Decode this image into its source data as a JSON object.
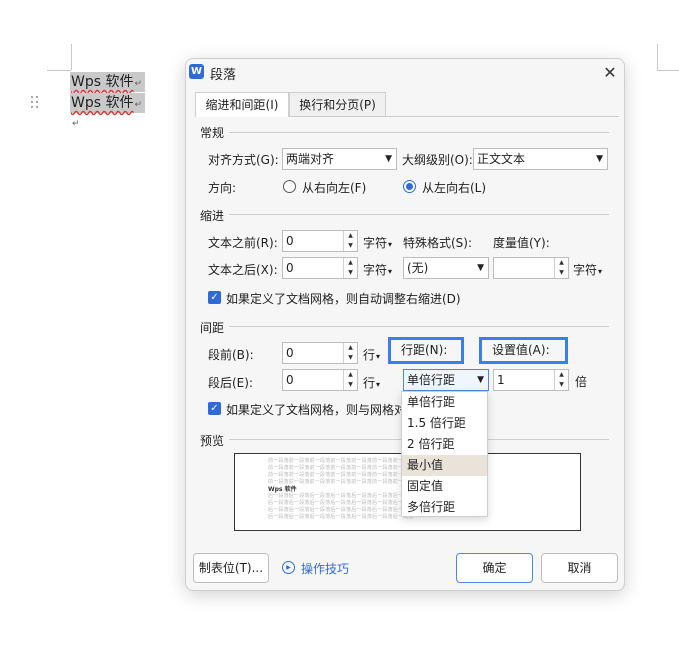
{
  "document": {
    "lines": [
      "Wps 软件",
      "Wps 软件"
    ],
    "para_mark": "↵"
  },
  "dialog": {
    "app_icon": "W",
    "title": "段落",
    "close_icon": "close-icon",
    "tabs": [
      "缩进和间距(I)",
      "换行和分页(P)"
    ],
    "general": {
      "heading": "常规",
      "align_label": "对齐方式(G):",
      "align_value": "两端对齐",
      "outline_label": "大纲级别(O):",
      "outline_value": "正文文本",
      "direction_label": "方向:",
      "rtl_label": "从右向左(F)",
      "ltr_label": "从左向右(L)",
      "direction_selected": "ltr"
    },
    "indent": {
      "heading": "缩进",
      "before_label": "文本之前(R):",
      "before_value": "0",
      "after_label": "文本之后(X):",
      "after_value": "0",
      "unit": "字符",
      "special_label": "特殊格式(S):",
      "special_value": "(无)",
      "measure_label": "度量值(Y):",
      "measure_value": "",
      "measure_unit": "字符",
      "grid_checkbox_label": "如果定义了文档网格，则自动调整右缩进(D)",
      "grid_checked": true
    },
    "spacing": {
      "heading": "间距",
      "before_label": "段前(B):",
      "before_value": "0",
      "after_label": "段后(E):",
      "after_value": "0",
      "unit": "行",
      "line_spacing_label": "行距(N):",
      "line_spacing_value": "单倍行距",
      "set_value_label": "设置值(A):",
      "set_value": "1",
      "set_value_unit": "倍",
      "grid_checkbox_label": "如果定义了文档网格，则与网格对",
      "grid_checked": true
    },
    "line_spacing_options": [
      "单倍行距",
      "1.5 倍行距",
      "2 倍行距",
      "最小值",
      "固定值",
      "多倍行距"
    ],
    "line_spacing_hover": "最小值",
    "preview": {
      "heading": "预览",
      "before_line": "前一段落前一段落前一段落前一段落前一段落前一段落前一段落",
      "sample_text": "Wps 软件",
      "after_line": "后一段落后一段落后一段落后一段落后一段落后一段落后一段落"
    },
    "buttons": {
      "tabs_button": "制表位(T)...",
      "tips_link": "操作技巧",
      "ok": "确定",
      "cancel": "取消"
    }
  },
  "colors": {
    "accent": "#2f6bd8",
    "highlight_border": "#3a7ff0",
    "hover_row": "#e9e3da"
  }
}
